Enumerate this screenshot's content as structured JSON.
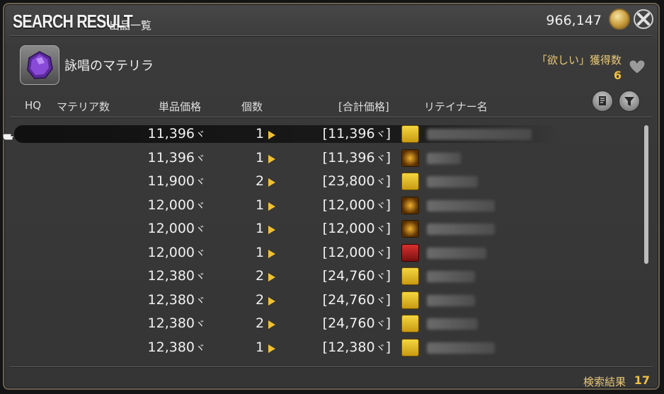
{
  "header": {
    "title": "SEARCH RESULT",
    "subtitle": "出品一覧",
    "gil": "966,147"
  },
  "item": {
    "name": "詠唱のマテリラ",
    "wish_label": "「欲しい」獲得数",
    "wish_count": "6"
  },
  "columns": {
    "hq": "HQ",
    "materia": "マテリア数",
    "unit_price": "単品価格",
    "quantity": "個数",
    "total": "[合計価格]",
    "retainer": "リテイナー名"
  },
  "listings": [
    {
      "unit": "11,396",
      "qty": "1",
      "total": "[11,396]",
      "class": "gold"
    },
    {
      "unit": "11,396",
      "qty": "1",
      "total": "[11,396]",
      "class": "scale"
    },
    {
      "unit": "11,900",
      "qty": "2",
      "total": "[23,800]",
      "class": "gold"
    },
    {
      "unit": "12,000",
      "qty": "1",
      "total": "[12,000]",
      "class": "scale"
    },
    {
      "unit": "12,000",
      "qty": "1",
      "total": "[12,000]",
      "class": "scale"
    },
    {
      "unit": "12,000",
      "qty": "1",
      "total": "[12,000]",
      "class": "red"
    },
    {
      "unit": "12,380",
      "qty": "2",
      "total": "[24,760]",
      "class": "gold"
    },
    {
      "unit": "12,380",
      "qty": "2",
      "total": "[24,760]",
      "class": "gold"
    },
    {
      "unit": "12,380",
      "qty": "2",
      "total": "[24,760]",
      "class": "gold"
    },
    {
      "unit": "12,380",
      "qty": "1",
      "total": "[12,380]",
      "class": "gold"
    }
  ],
  "currency_symbol": "ヾ",
  "footer": {
    "label": "検索結果",
    "count": "17"
  },
  "colors": {
    "accent_gold": "#f0c040",
    "label_gold": "#e8c878"
  }
}
